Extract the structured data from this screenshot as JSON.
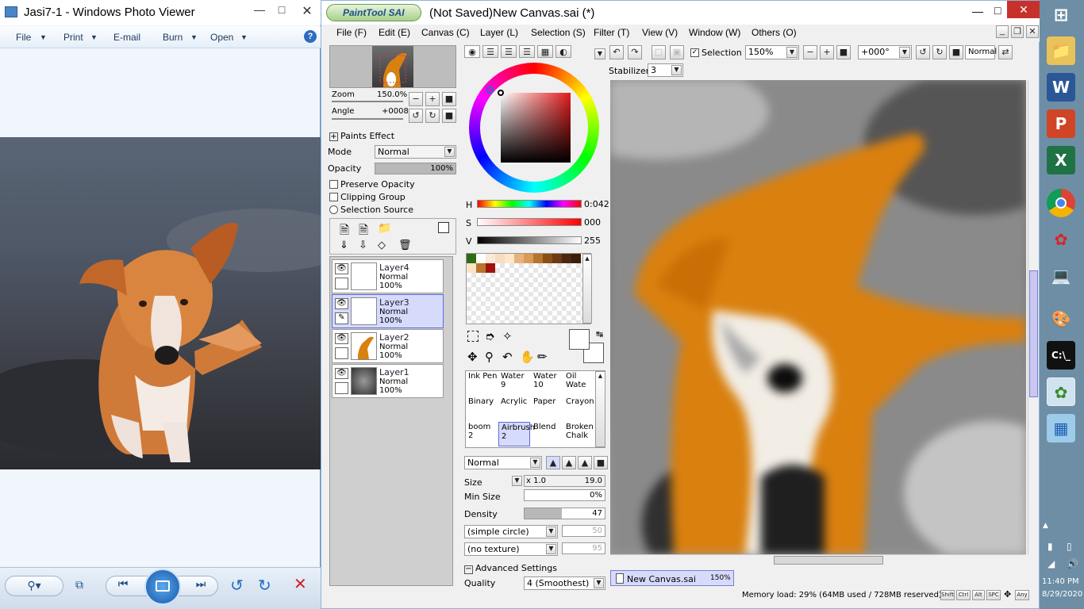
{
  "photo_viewer": {
    "title": "Jasi7-1 - Windows Photo Viewer",
    "menu": [
      "File",
      "Print",
      "E-mail",
      "Burn",
      "Open"
    ],
    "help_icon": "help-icon"
  },
  "sai": {
    "logo": "PaintTool SAI",
    "title": "(Not Saved)New Canvas.sai (*)",
    "menu": [
      "File (F)",
      "Edit (E)",
      "Canvas (C)",
      "Layer (L)",
      "Selection (S)",
      "Filter (T)",
      "View (V)",
      "Window (W)",
      "Others (O)"
    ],
    "navigator": {
      "zoom_label": "Zoom",
      "zoom_value": "150.0%",
      "angle_label": "Angle",
      "angle_value": "+0008"
    },
    "paints_effect": "Paints Effect",
    "mode_label": "Mode",
    "mode_value": "Normal",
    "opacity_label": "Opacity",
    "opacity_value": "100%",
    "opacity_level": 1.0,
    "preserve_opacity": "Preserve Opacity",
    "clipping_group": "Clipping Group",
    "selection_source": "Selection Source",
    "layers": [
      {
        "name": "Layer4",
        "mode": "Normal",
        "opacity": "100%"
      },
      {
        "name": "Layer3",
        "mode": "Normal",
        "opacity": "100%"
      },
      {
        "name": "Layer2",
        "mode": "Normal",
        "opacity": "100%"
      },
      {
        "name": "Layer1",
        "mode": "Normal",
        "opacity": "100%"
      }
    ],
    "hsv": {
      "h_label": "H",
      "h_value": "0:042",
      "s_label": "S",
      "s_value": "000",
      "v_label": "V",
      "v_value": "255"
    },
    "tools": [
      [
        "Ink Pen",
        "Water\n9",
        "Water\n10",
        "Oil Wate"
      ],
      [
        "Binary",
        "Acrylic",
        "Paper",
        "Crayon"
      ],
      [
        "boom\n2",
        "Airbrush\n2",
        "Blend",
        "Broken\nChalk"
      ]
    ],
    "brush_mode": "Normal",
    "size_label": "Size",
    "size_mult": "x 1.0",
    "size_value": "19.0",
    "min_size_label": "Min Size",
    "min_size_value": "0%",
    "density_label": "Density",
    "density_value": "47",
    "density_level": 0.47,
    "shape": "(simple circle)",
    "shape_value": "50",
    "texture": "(no texture)",
    "texture_value": "95",
    "advanced": "Advanced Settings",
    "quality_label": "Quality",
    "quality_value": "4 (Smoothest)",
    "toolbar": {
      "selection": "Selection",
      "zoom": "150%",
      "angle": "+000°",
      "blend": "Normal",
      "stabilizer_label": "Stabilizer",
      "stabilizer_value": "3"
    },
    "canvas_tab": {
      "name": "New Canvas.sai",
      "zoom": "150%"
    },
    "status": "Memory load: 29% (64MB used / 728MB reserved)",
    "keys": [
      "Shift",
      "Ctrl",
      "Alt",
      "SPC",
      "Any"
    ]
  },
  "taskbar": {
    "time": "11:40 PM",
    "date": "8/29/2020"
  },
  "colors": {
    "accent": "#d9800f",
    "sel_blue": "#d6dbfc",
    "title_blue": "#6a93c0"
  }
}
